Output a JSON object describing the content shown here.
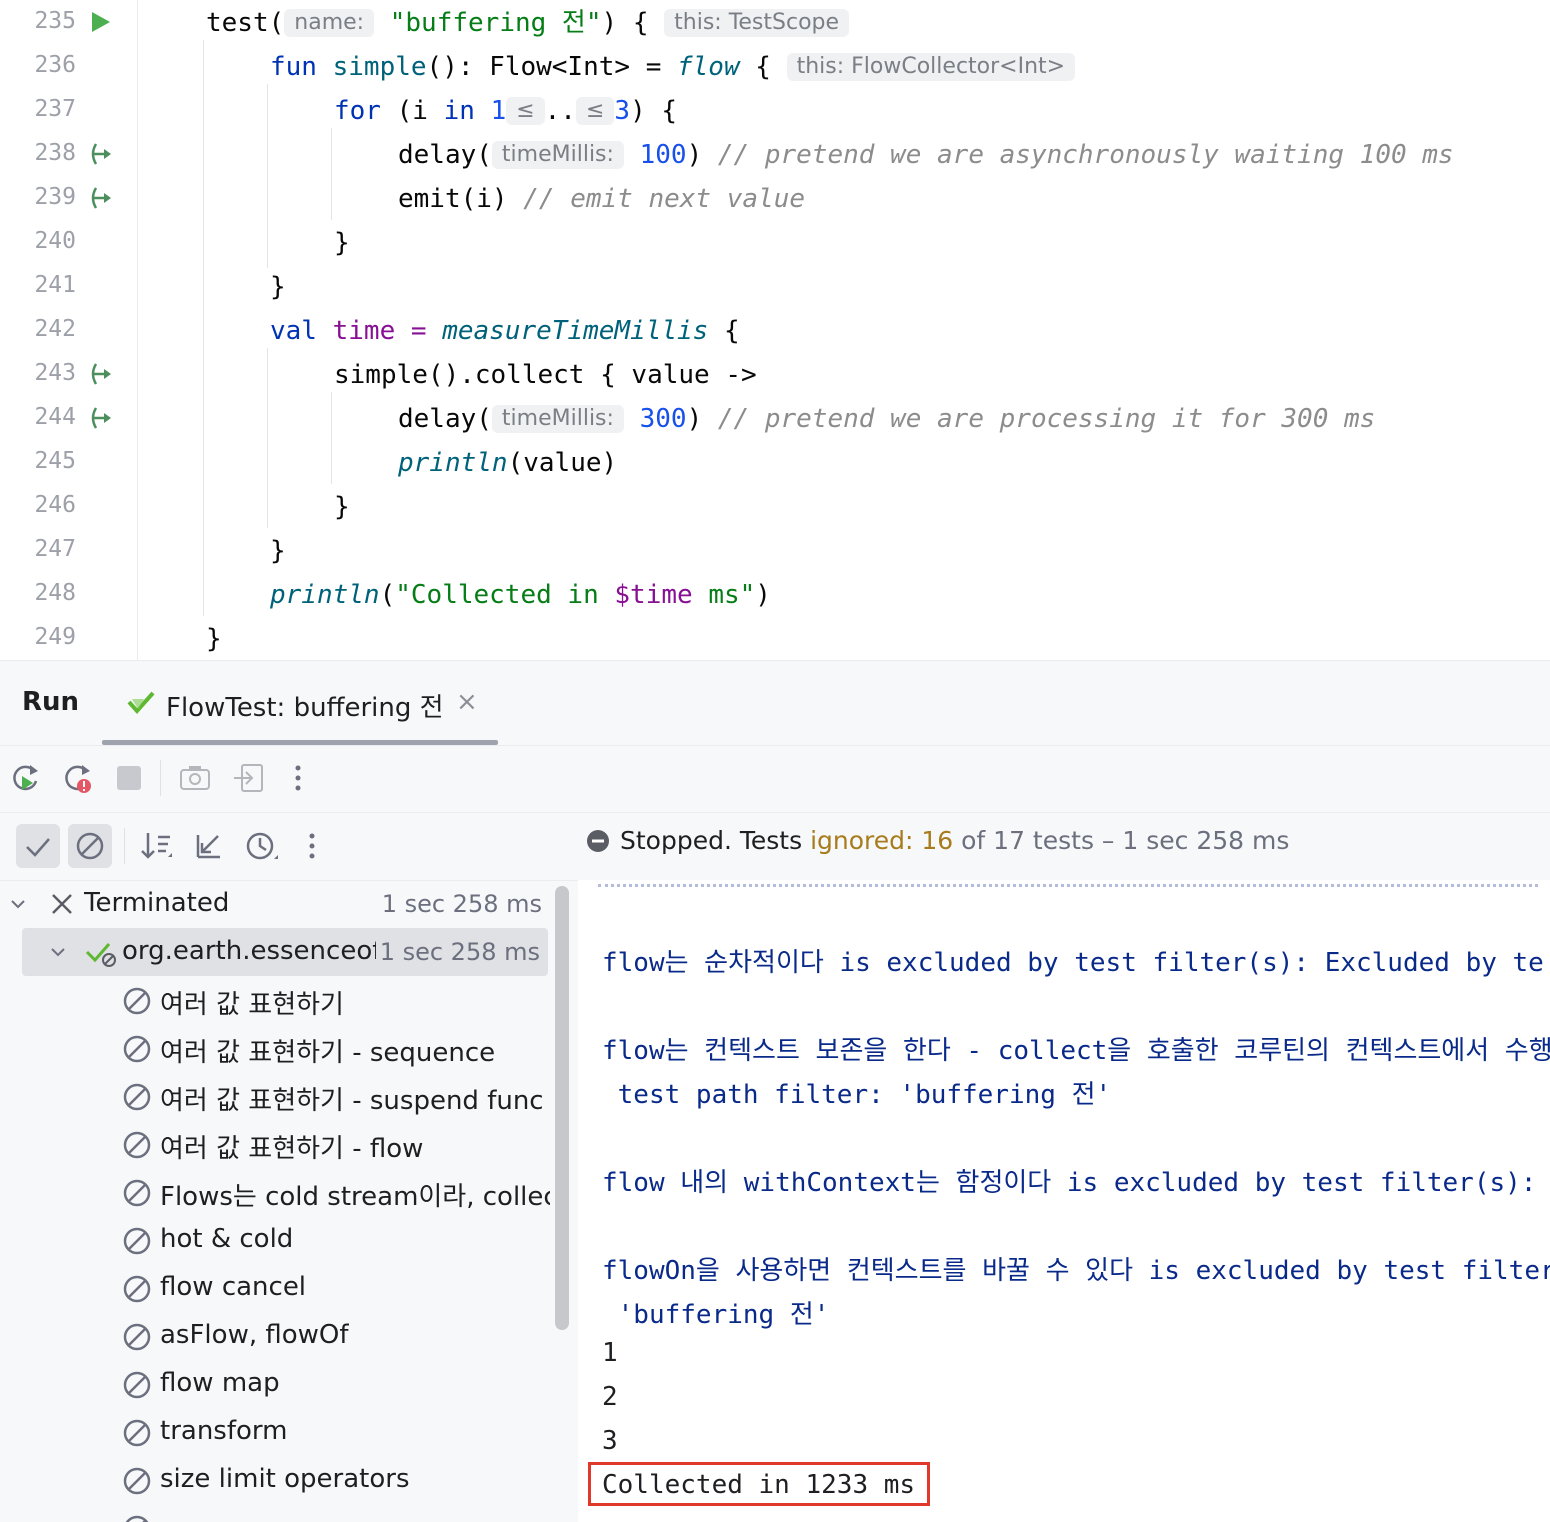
{
  "editor": {
    "line_numbers": [
      "235",
      "236",
      "237",
      "238",
      "239",
      "240",
      "241",
      "242",
      "243",
      "244",
      "245",
      "246",
      "247",
      "248",
      "249"
    ],
    "gutter_icons": {
      "run": "run-test-icon",
      "suspend": "suspend-call-icon"
    },
    "code": {
      "l235_test": "test(",
      "l235_hint": "name:",
      "l235_str": "\"buffering 전\"",
      "l235_close": ") {",
      "l235_hint2": "this: TestScope",
      "l236_fun": "fun",
      "l236_name": "simple",
      "l236_sig": "(): Flow<Int> = ",
      "l236_flow": "flow",
      "l236_brace": " {",
      "l236_hint": "this: FlowCollector<Int>",
      "l237_for": "for",
      "l237_open": " (i ",
      "l237_in": "in",
      "l237_one": "1",
      "l237_le1": "≤",
      "l237_dots": "..",
      "l237_le2": "≤",
      "l237_three": "3",
      "l237_close": ") {",
      "l238_delay": "delay(",
      "l238_hint": "timeMillis:",
      "l238_num": "100",
      "l238_close": ")",
      "l238_cmt": "// pretend we are asynchronously waiting 100 ms",
      "l239_emit": "emit(i)",
      "l239_cmt": "// emit next value",
      "l240": "}",
      "l241": "}",
      "l242_val": "val",
      "l242_time": " time = ",
      "l242_fn": "measureTimeMillis",
      "l242_brace": " {",
      "l243": "simple().collect { value ->",
      "l244_delay": "delay(",
      "l244_hint": "timeMillis:",
      "l244_num": "300",
      "l244_close": ")",
      "l244_cmt": "// pretend we are processing it for 300 ms",
      "l245_fn": "println",
      "l245_rest": "(value)",
      "l246": "}",
      "l247": "}",
      "l248_fn": "println",
      "l248_open": "(",
      "l248_s1": "\"Collected in ",
      "l248_tmpl": "$time",
      "l248_s2": " ms\"",
      "l248_close": ")",
      "l249": "}"
    }
  },
  "run_panel": {
    "title": "Run",
    "tab_label": "FlowTest: buffering 전",
    "tab_close": "×",
    "status": {
      "prefix": "Stopped. Tests ",
      "ignored": "ignored: 16",
      "suffix": " of 17 tests – 1 sec 258 ms"
    },
    "tree": [
      {
        "label": "Terminated",
        "time": "1 sec 258 ms"
      },
      {
        "label": "org.earth.essenceofkotlin",
        "time": "1 sec 258 ms"
      },
      {
        "label": "여러 값 표현하기"
      },
      {
        "label": "여러 값 표현하기 - sequence"
      },
      {
        "label": "여러 값 표현하기 - suspend func"
      },
      {
        "label": "여러 값 표현하기 - flow"
      },
      {
        "label": "Flows는 cold stream이라, collect"
      },
      {
        "label": "hot & cold"
      },
      {
        "label": "flow cancel"
      },
      {
        "label": "asFlow, flowOf"
      },
      {
        "label": "flow map"
      },
      {
        "label": "transform"
      },
      {
        "label": "size limit operators"
      }
    ],
    "console": [
      "flow는 순차적이다 is excluded by test filter(s): Excluded by te",
      "flow는 컨텍스트 보존을 한다 - collect을 호출한 코루틴의 컨텍스트에서 수행함",
      " test path filter: 'buffering 전'",
      "flow 내의 withContext는 함정이다 is excluded by test filter(s):",
      "flowOn을 사용하면 컨텍스트를 바꿀 수 있다 is excluded by test filter(",
      " 'buffering 전'",
      "1",
      "2",
      "3",
      "Collected in 1233 ms"
    ]
  },
  "colors": {
    "keyword": "#0033b3",
    "string": "#067d17",
    "number": "#1750eb",
    "comment": "#8c8c8c",
    "ignored": "#a87c1c",
    "highlight_box": "#e0392b"
  }
}
